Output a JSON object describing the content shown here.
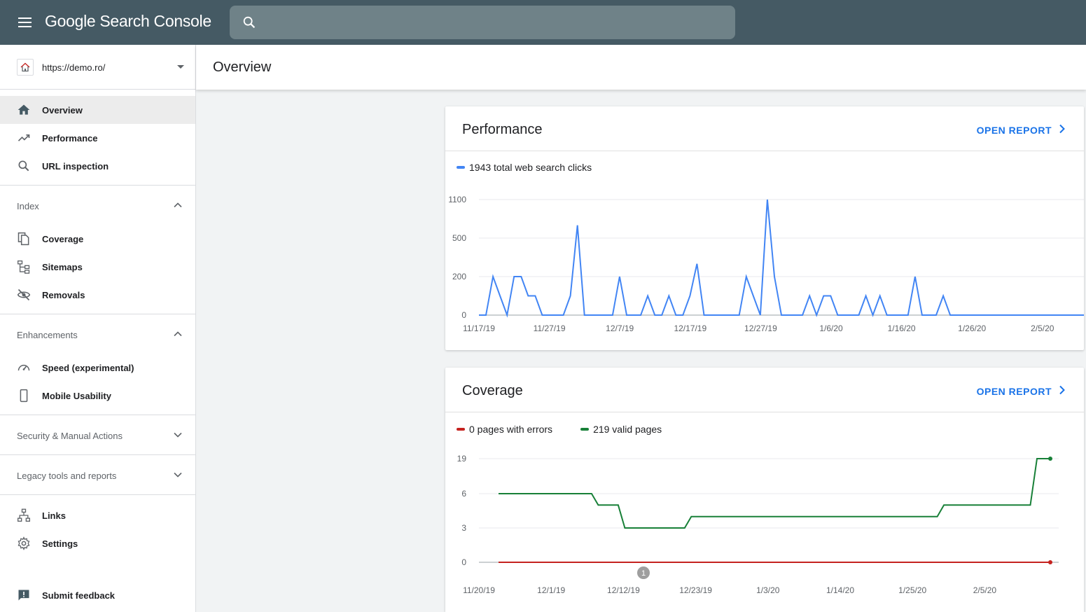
{
  "app": {
    "title": "Google Search Console"
  },
  "search": {
    "placeholder": ""
  },
  "property": {
    "url": "https://demo.ro/"
  },
  "sidebar": {
    "top_items": [
      {
        "label": "Overview",
        "icon": "home-icon",
        "active": true
      },
      {
        "label": "Performance",
        "icon": "trending-up-icon"
      },
      {
        "label": "URL inspection",
        "icon": "search-icon"
      }
    ],
    "index": {
      "label": "Index",
      "expanded": true,
      "items": [
        {
          "label": "Coverage",
          "icon": "file-copy-icon"
        },
        {
          "label": "Sitemaps",
          "icon": "sitemap-icon"
        },
        {
          "label": "Removals",
          "icon": "eye-off-icon"
        }
      ]
    },
    "enhancements": {
      "label": "Enhancements",
      "expanded": true,
      "items": [
        {
          "label": "Speed (experimental)",
          "icon": "speedometer-icon"
        },
        {
          "label": "Mobile Usability",
          "icon": "phone-icon"
        }
      ]
    },
    "security": {
      "label": "Security & Manual Actions",
      "expanded": false
    },
    "legacy": {
      "label": "Legacy tools and reports",
      "expanded": false
    },
    "bottom_items": [
      {
        "label": "Links",
        "icon": "links-icon"
      },
      {
        "label": "Settings",
        "icon": "gear-icon"
      }
    ],
    "feedback": {
      "label": "Submit feedback",
      "icon": "feedback-icon"
    }
  },
  "header": {
    "title": "Overview"
  },
  "performance": {
    "title": "Performance",
    "open_label": "OPEN REPORT",
    "legend": "1943 total web search clicks",
    "line_color": "#4285f4"
  },
  "coverage": {
    "title": "Coverage",
    "open_label": "OPEN REPORT",
    "legend_errors": "0 pages with errors",
    "legend_valid": "219 valid pages",
    "error_color": "#c5221f",
    "valid_color": "#188038",
    "annotation": "1"
  },
  "chart_data": [
    {
      "type": "line",
      "scale": "nonlinear",
      "ylabel": "",
      "xlabel": "",
      "y_ticks": [
        0,
        200,
        500,
        1100
      ],
      "x_tick_labels": [
        "11/17/19",
        "11/27/19",
        "12/7/19",
        "12/17/19",
        "12/27/19",
        "1/6/20",
        "1/16/20",
        "1/26/20",
        "2/5/20"
      ],
      "grid": true,
      "legend_position": "top-left",
      "series": [
        {
          "name": "1943 total web search clicks",
          "values": [
            0,
            0,
            200,
            100,
            0,
            200,
            200,
            100,
            100,
            0,
            0,
            0,
            0,
            100,
            700,
            0,
            0,
            0,
            0,
            0,
            200,
            0,
            0,
            0,
            100,
            0,
            0,
            100,
            0,
            0,
            100,
            300,
            0,
            0,
            0,
            0,
            0,
            0,
            200,
            100,
            0,
            1100,
            200,
            0,
            0,
            0,
            0,
            100,
            0,
            100,
            100,
            0,
            0,
            0,
            0,
            100,
            0,
            100,
            0,
            0,
            0,
            0,
            200,
            0,
            0,
            0,
            100,
            0,
            0,
            0,
            0,
            0,
            0,
            0,
            0,
            0,
            0,
            0,
            0,
            0,
            0,
            0,
            0,
            0,
            0,
            0,
            0
          ]
        }
      ]
    },
    {
      "type": "line",
      "scale": "nonlinear",
      "ylabel": "",
      "xlabel": "",
      "y_ticks": [
        0,
        3,
        6,
        19
      ],
      "x_tick_labels": [
        "11/20/19",
        "12/1/19",
        "12/12/19",
        "12/23/19",
        "1/3/20",
        "1/14/20",
        "1/25/20",
        "2/5/20"
      ],
      "grid": true,
      "legend_position": "top-left",
      "series": [
        {
          "name": "219 valid pages",
          "steps": [
            [
              0,
              6
            ],
            [
              14,
              6
            ],
            [
              15,
              5
            ],
            [
              18,
              5
            ],
            [
              19,
              3
            ],
            [
              28,
              3
            ],
            [
              29,
              4
            ],
            [
              66,
              4
            ],
            [
              67,
              5
            ],
            [
              80,
              5
            ],
            [
              81,
              19
            ],
            [
              83,
              19
            ]
          ]
        },
        {
          "name": "0 pages with errors",
          "steps": [
            [
              0,
              0
            ],
            [
              83,
              0
            ]
          ]
        }
      ]
    }
  ]
}
